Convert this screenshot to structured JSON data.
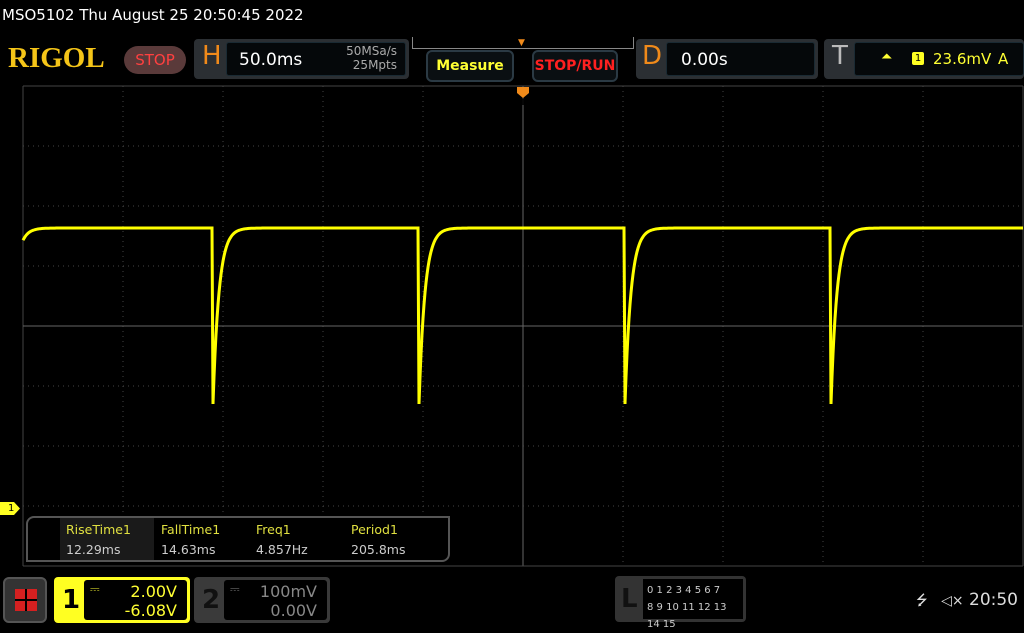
{
  "header": {
    "title": "MSO5102  Thu August 25 20:50:45 2022",
    "logo": "RIGOL",
    "run_state": "STOP"
  },
  "horizontal": {
    "label": "H",
    "timebase": "50.0ms",
    "sample_rate": "50MSa/s",
    "memory_depth": "25Mpts"
  },
  "buttons": {
    "measure": "Measure",
    "stop_run": "STOP/RUN"
  },
  "delay": {
    "label": "D",
    "value": "0.00s"
  },
  "trigger": {
    "label": "T",
    "edge_icon": "rising-edge-icon",
    "source": "1",
    "level": "23.6mV",
    "mode": "A"
  },
  "measurements": [
    {
      "name": "RiseTime1",
      "value": "12.29ms"
    },
    {
      "name": "FallTime1",
      "value": "14.63ms"
    },
    {
      "name": "Freq1",
      "value": "4.857Hz"
    },
    {
      "name": "Period1",
      "value": "205.8ms"
    }
  ],
  "channels": [
    {
      "num": "1",
      "scale": "2.00V",
      "offset": "-6.08V",
      "coupling_icon": "dc-icon",
      "active": true,
      "color": "#ffff22"
    },
    {
      "num": "2",
      "scale": "100mV",
      "offset": "0.00V",
      "coupling_icon": "dc-icon",
      "active": false,
      "color": "#888888"
    }
  ],
  "channel_marker": "1",
  "logic": {
    "label": "L",
    "row1": "0 1 2 3   4 5 6 7",
    "row2": "8 9 10 11 12 13 14 15"
  },
  "status": {
    "time": "20:50",
    "usb_icon": "usb-icon",
    "sound_icon": "mute-icon"
  },
  "colors": {
    "trace": "#ffff00",
    "accent": "#f08a1a",
    "grid": "#555555"
  }
}
